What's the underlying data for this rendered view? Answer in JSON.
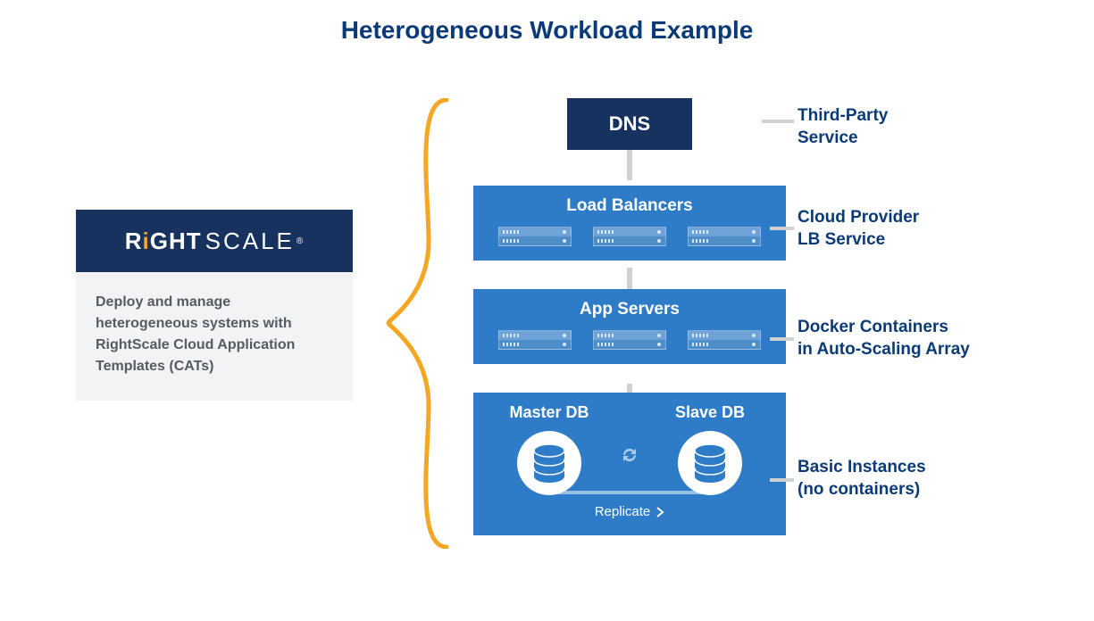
{
  "title": "Heterogeneous Workload Example",
  "card": {
    "logo_r": "R",
    "logo_i": "i",
    "logo_ght": "GHT",
    "logo_scale": "SCALE",
    "logo_reg": "®",
    "desc": "Deploy and manage heterogeneous systems with RightScale Cloud Application Templates (CATs)"
  },
  "tiers": {
    "dns": "DNS",
    "lb": "Load Balancers",
    "app": "App Servers",
    "db_master": "Master DB",
    "db_slave": "Slave DB",
    "replicate": "Replicate"
  },
  "labels": {
    "dns": "Third-Party Service",
    "lb": "Cloud Provider LB Service",
    "app": "Docker Containers in Auto-Scaling Array",
    "db": "Basic Instances (no containers)"
  },
  "colors": {
    "navy": "#17325f",
    "blue": "#2e7cc7",
    "orange": "#f5a623",
    "text": "#0b3a78"
  }
}
